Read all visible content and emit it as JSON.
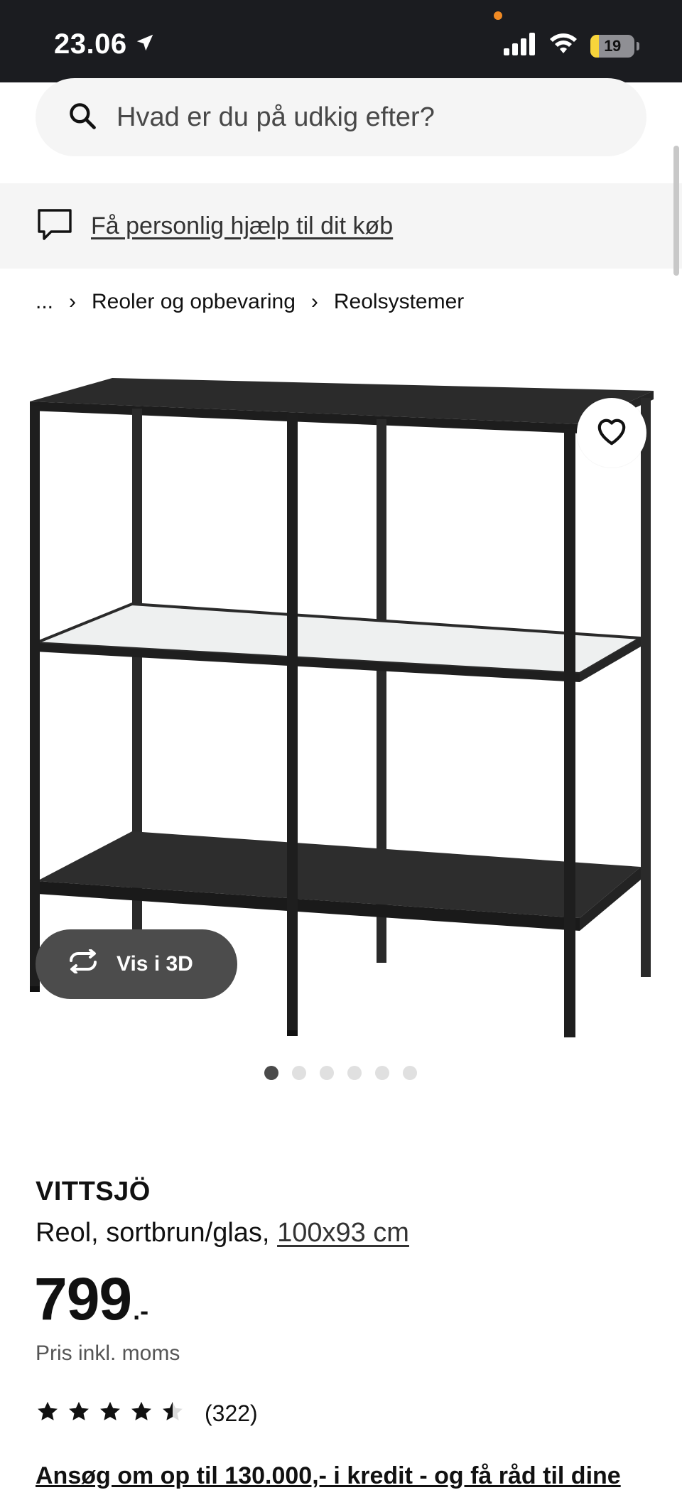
{
  "status_bar": {
    "time": "23.06",
    "battery": "19",
    "battery_level": 0.19
  },
  "search": {
    "placeholder": "Hvad er du på udkig efter?"
  },
  "help": {
    "link_text": "Få personlig hjælp til dit køb"
  },
  "breadcrumb": {
    "items": [
      "...",
      "Reoler og opbevaring",
      "Reolsystemer"
    ]
  },
  "gallery": {
    "view_3d_label": "Vis i 3D",
    "total_images": 6,
    "active_index": 0
  },
  "product": {
    "name": "VITTSJÖ",
    "description": "Reol, sortbrun/glas, ",
    "size": "100x93 cm",
    "price": "799",
    "price_suffix": ".-",
    "vat_note": "Pris inkl. moms",
    "rating": 4.5,
    "review_count": "(322)",
    "promo_text": "Ansøg om op til 130.000,- i kredit - og få råd til dine"
  },
  "colors": {
    "status_bar_bg": "#1b1c20",
    "light_gray_bg": "#f5f5f5",
    "button_dark": "#4c4c4c",
    "battery_yellow": "#f7d43b"
  }
}
